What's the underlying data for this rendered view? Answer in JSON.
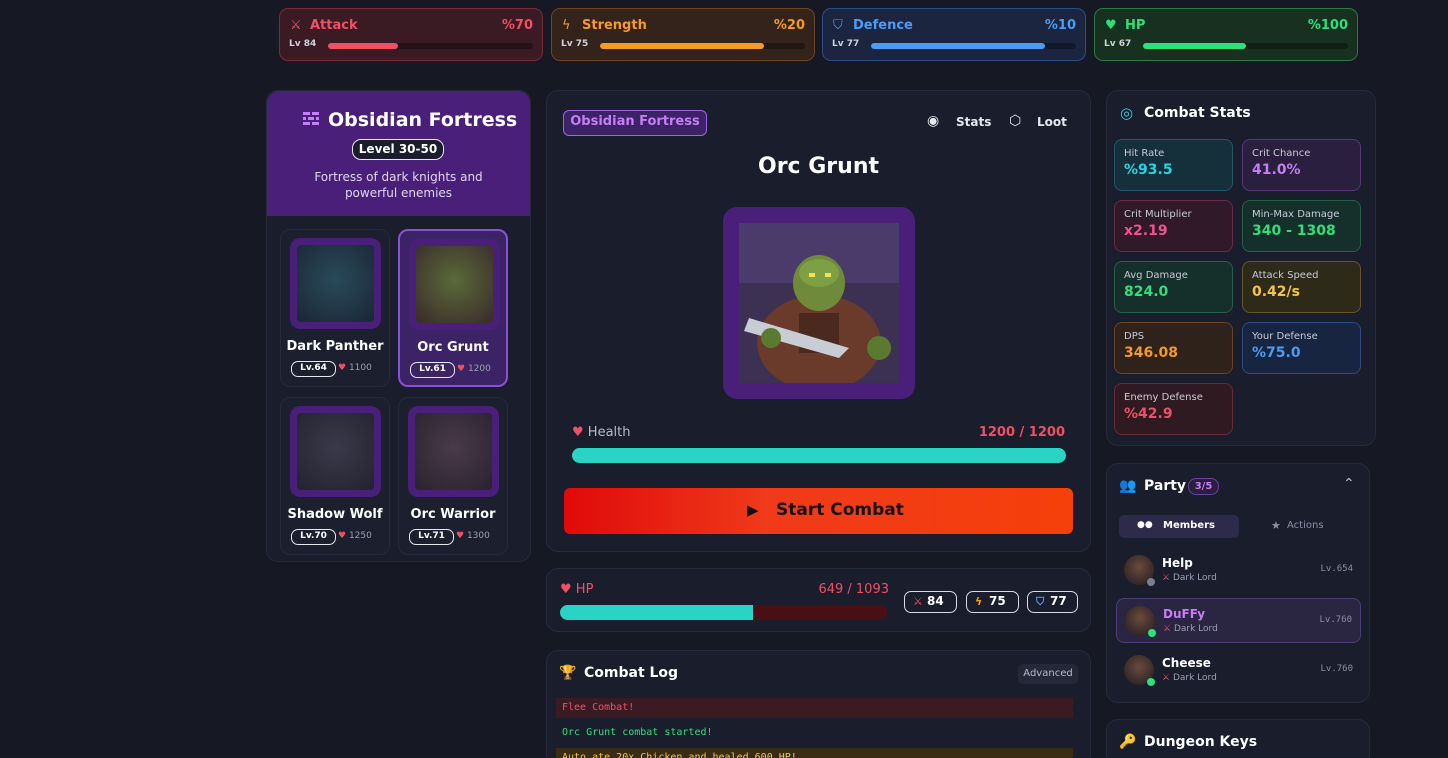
{
  "top_stats": [
    {
      "name": "Attack",
      "icon": "sword-icon",
      "pct": "%70",
      "lv": "Lv 84",
      "progress": 0.34,
      "color": "#f05064",
      "bg": "#3a1b24",
      "border": "#7a2a36"
    },
    {
      "name": "Strength",
      "icon": "lightning-icon",
      "pct": "%20",
      "lv": "Lv 75",
      "progress": 0.8,
      "color": "#f59a23",
      "bg": "#33231a",
      "border": "#6e4421"
    },
    {
      "name": "Defence",
      "icon": "shield-icon",
      "pct": "%10",
      "lv": "Lv 77",
      "progress": 0.85,
      "color": "#4a9cf5",
      "bg": "#1b2540",
      "border": "#2d4c86"
    },
    {
      "name": "HP",
      "icon": "heart-icon",
      "pct": "%100",
      "lv": "Lv 67",
      "progress": 0.5,
      "color": "#2ee07a",
      "bg": "#17301f",
      "border": "#2a7a45"
    }
  ],
  "dungeon": {
    "title": "Obsidian Fortress",
    "level": "Level 30-50",
    "description": "Fortress of dark knights and powerful enemies",
    "enemies": [
      {
        "name": "Dark Panther",
        "level": "Lv.64",
        "hp": "1100",
        "selected": false
      },
      {
        "name": "Orc Grunt",
        "level": "Lv.61",
        "hp": "1200",
        "selected": true
      },
      {
        "name": "Shadow Wolf",
        "level": "Lv.70",
        "hp": "1250",
        "selected": false
      },
      {
        "name": "Orc Warrior",
        "level": "Lv.71",
        "hp": "1300",
        "selected": false
      }
    ]
  },
  "battle": {
    "tag": "Obsidian Fortress",
    "stats_label": "Stats",
    "loot_label": "Loot",
    "enemy_name": "Orc Grunt",
    "health_label": "Health",
    "health_value": "1200 / 1200",
    "health_fraction": 1.0,
    "start_label": "Start Combat"
  },
  "player": {
    "hp_label": "HP",
    "hp_value": "649 / 1093",
    "hp_fraction": 0.59,
    "attack": "84",
    "strength": "75",
    "defence": "77"
  },
  "combat_log": {
    "title": "Combat Log",
    "advanced_label": "Advanced",
    "entries": [
      {
        "text": "Flee Combat!",
        "color": "#f05064",
        "bg": "#3a1b24"
      },
      {
        "text": "Orc Grunt combat started!",
        "color": "#2ee07a",
        "bg": "transparent"
      },
      {
        "text": "Auto ate 20x Chicken and healed 600 HP!",
        "color": "#f5c542",
        "bg": "#3a2c14"
      }
    ]
  },
  "combat_stats": {
    "title": "Combat Stats",
    "items": [
      {
        "label": "Hit Rate",
        "value": "%93.5",
        "color": "#2ad4e0",
        "bg": "#15303a",
        "border": "#1f5a66"
      },
      {
        "label": "Crit Chance",
        "value": "41.0%",
        "color": "#c77df5",
        "bg": "#2a1f3e",
        "border": "#56377a"
      },
      {
        "label": "Crit Multiplier",
        "value": "x2.19",
        "color": "#f5508a",
        "bg": "#301a2a",
        "border": "#6a2a4a"
      },
      {
        "label": "Min-Max Damage",
        "value": "340 - 1308",
        "color": "#2ee07a",
        "bg": "#15302a",
        "border": "#236148"
      },
      {
        "label": "Avg Damage",
        "value": "824.0",
        "color": "#2ee07a",
        "bg": "#15302a",
        "border": "#236148"
      },
      {
        "label": "Attack Speed",
        "value": "0.42/s",
        "color": "#f5c542",
        "bg": "#2e2a1a",
        "border": "#66562a"
      },
      {
        "label": "DPS",
        "value": "346.08",
        "color": "#f59a23",
        "bg": "#2e221a",
        "border": "#6a4224"
      },
      {
        "label": "Your Defense",
        "value": "%75.0",
        "color": "#4a9cf5",
        "bg": "#182540",
        "border": "#2d4c86"
      },
      {
        "label": "Enemy Defense",
        "value": "%42.9",
        "color": "#f05064",
        "bg": "#301a22",
        "border": "#6a2a36"
      }
    ]
  },
  "party": {
    "title": "Party",
    "count": "3/5",
    "tab_members": "Members",
    "tab_actions": "Actions",
    "members": [
      {
        "name": "Help",
        "class": "Dark Lord",
        "level": "Lv.654",
        "status": "#7a7f90",
        "selected": false,
        "name_color": "#ffffff"
      },
      {
        "name": "DuFFy",
        "class": "Dark Lord",
        "level": "Lv.760",
        "status": "#2ee07a",
        "selected": true,
        "name_color": "#c77df5"
      },
      {
        "name": "Cheese",
        "class": "Dark Lord",
        "level": "Lv.760",
        "status": "#2ee07a",
        "selected": false,
        "name_color": "#ffffff"
      }
    ]
  },
  "dungeon_keys": {
    "title": "Dungeon Keys"
  }
}
